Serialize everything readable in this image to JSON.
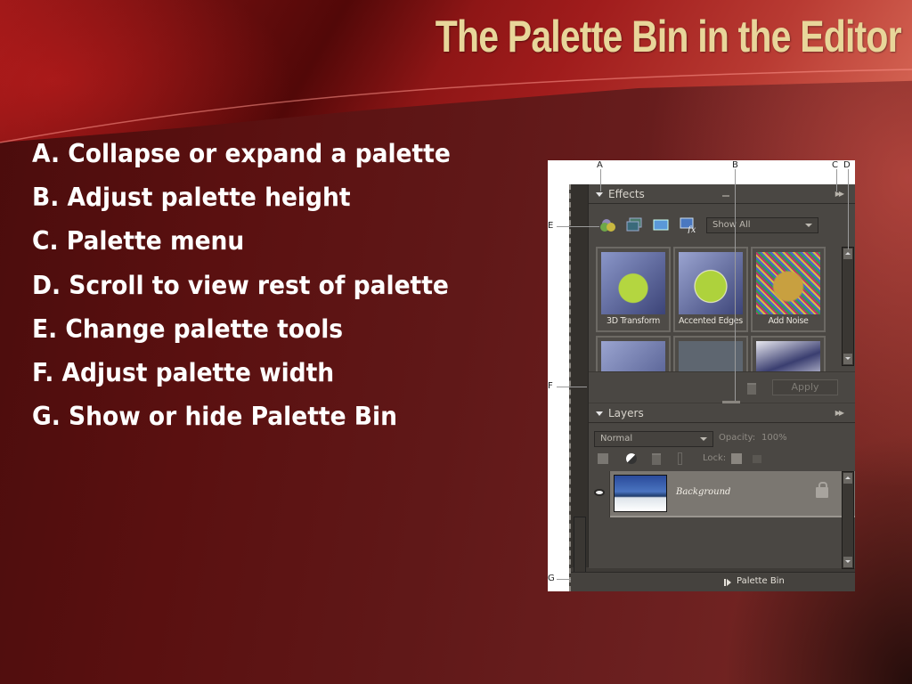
{
  "slide": {
    "title": "The Palette Bin in the Editor",
    "bullets": [
      "A. Collapse or expand a palette",
      "B. Adjust palette height",
      "C. Palette menu",
      "D. Scroll to view rest of palette",
      "E. Change palette tools",
      "F. Adjust palette width",
      "G. Show or hide Palette Bin"
    ],
    "colors": {
      "title": "#e8d69a",
      "bullet_text": "#ffffff",
      "background": "#5a1010",
      "panel": "#3e3b37"
    }
  },
  "screenshot": {
    "callouts": [
      "A",
      "B",
      "C",
      "D",
      "E",
      "F",
      "G"
    ],
    "effects_palette": {
      "title": "Effects",
      "collapse_icon": "triangle-down-icon",
      "menu_icon": "double-arrow-right-icon",
      "tool_icons": [
        "filters-icon",
        "layer-styles-icon",
        "photo-effects-icon",
        "all-effects-icon"
      ],
      "filter_dropdown": "Show All",
      "thumbnails": [
        {
          "label": "3D Transform"
        },
        {
          "label": "Accented Edges"
        },
        {
          "label": "Add Noise"
        },
        {
          "label": ""
        },
        {
          "label": ""
        },
        {
          "label": ""
        }
      ],
      "apply_label": "Apply",
      "delete_icon": "trash-icon"
    },
    "layers_palette": {
      "title": "Layers",
      "blend_mode": "Normal",
      "opacity_label": "Opacity:",
      "opacity_value": "100%",
      "lock_label": "Lock:",
      "layers": [
        {
          "name": "Background",
          "visible": true,
          "locked": true
        }
      ]
    },
    "palette_bin_label": "Palette Bin"
  }
}
